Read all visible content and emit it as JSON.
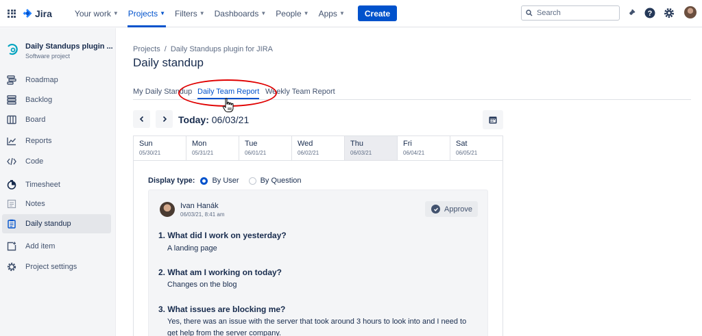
{
  "topnav": {
    "logo": "Jira",
    "items": [
      {
        "label": "Your work"
      },
      {
        "label": "Projects"
      },
      {
        "label": "Filters"
      },
      {
        "label": "Dashboards"
      },
      {
        "label": "People"
      },
      {
        "label": "Apps"
      }
    ],
    "create_label": "Create",
    "search_placeholder": "Search",
    "accent": "#0052cc"
  },
  "sidebar": {
    "project_title": "Daily Standups plugin ...",
    "project_type": "Software project",
    "items": [
      {
        "label": "Roadmap",
        "icon": "roadmap-icon"
      },
      {
        "label": "Backlog",
        "icon": "backlog-icon"
      },
      {
        "label": "Board",
        "icon": "board-icon"
      },
      {
        "label": "Reports",
        "icon": "reports-icon"
      },
      {
        "label": "Code",
        "icon": "code-icon"
      },
      {
        "label": "Timesheet",
        "icon": "timesheet-icon"
      },
      {
        "label": "Notes",
        "icon": "notes-icon"
      },
      {
        "label": "Daily standup",
        "icon": "daily-standup-icon"
      },
      {
        "label": "Add item",
        "icon": "add-item-icon"
      },
      {
        "label": "Project settings",
        "icon": "gear-icon"
      }
    ]
  },
  "main": {
    "breadcrumb": {
      "root": "Projects",
      "separator": "/",
      "project": "Daily Standups plugin for JIRA"
    },
    "title": "Daily standup",
    "tabs": [
      {
        "label": "My Daily Standup"
      },
      {
        "label": "Daily Team Report"
      },
      {
        "label": "Weekly Team Report"
      }
    ],
    "today_label": "Today:",
    "today_date": "06/03/21",
    "days": [
      {
        "name": "Sun",
        "date": "05/30/21"
      },
      {
        "name": "Mon",
        "date": "05/31/21"
      },
      {
        "name": "Tue",
        "date": "06/01/21"
      },
      {
        "name": "Wed",
        "date": "06/02/21"
      },
      {
        "name": "Thu",
        "date": "06/03/21"
      },
      {
        "name": "Fri",
        "date": "06/04/21"
      },
      {
        "name": "Sat",
        "date": "06/05/21"
      }
    ],
    "display_type": {
      "label": "Display type:",
      "options": [
        "By User",
        "By Question"
      ],
      "selected": "By User"
    },
    "report": {
      "user_name": "Ivan Hanák",
      "timestamp": "06/03/21, 8:41 am",
      "approve_label": "Approve",
      "questions": [
        {
          "q": "1. What did I work on yesterday?",
          "a": "A landing page"
        },
        {
          "q": "2. What am I working on today?",
          "a": "Changes on the blog"
        },
        {
          "q": "3. What issues are blocking me?",
          "a": "Yes, there was an issue with the server that took around 3 hours to look into and I need to get help from the server company."
        }
      ]
    }
  }
}
